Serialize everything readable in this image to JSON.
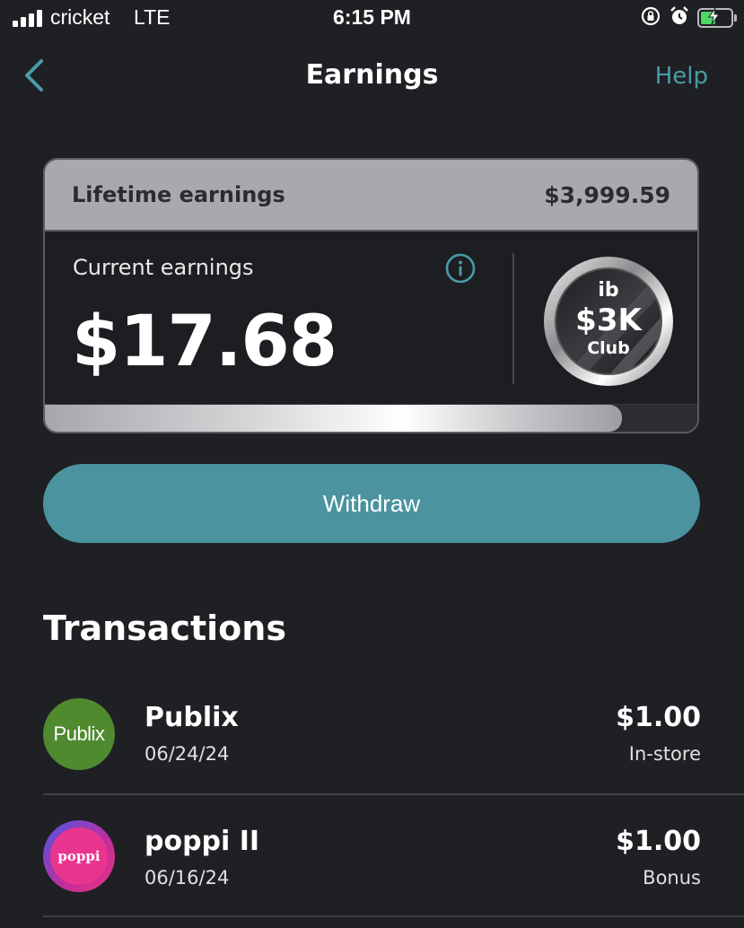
{
  "status_bar": {
    "carrier": "cricket",
    "network": "LTE",
    "time": "6:15 PM",
    "battery_level": 0.52,
    "icons": [
      "signal-icon",
      "orientation-lock-icon",
      "alarm-icon",
      "battery-charging-icon"
    ]
  },
  "nav": {
    "back_icon": "chevron-left-icon",
    "title": "Earnings",
    "help_label": "Help"
  },
  "earnings_card": {
    "lifetime_label": "Lifetime earnings",
    "lifetime_value": "$3,999.59",
    "current_label": "Current earnings",
    "current_value": "$17.68",
    "info_icon": "info-icon",
    "badge": {
      "brand": "ib",
      "title": "$3K",
      "subtitle": "Club"
    },
    "progress_fraction": 0.885
  },
  "withdraw_label": "Withdraw",
  "transactions": {
    "title": "Transactions",
    "items": [
      {
        "logo_text": "Publix",
        "name": "Publix",
        "date": "06/24/24",
        "amount": "$1.00",
        "type": "In-store"
      },
      {
        "logo_text": "poppi",
        "name": "poppi II",
        "date": "06/16/24",
        "amount": "$1.00",
        "type": "Bonus"
      }
    ]
  },
  "colors": {
    "background": "#1f2024",
    "accent": "#4a939f",
    "help_text": "#4a9ba6",
    "card_header": "#a8a9ac",
    "publix_green": "#4f8a2f",
    "poppi_pink": "#e9358f"
  }
}
